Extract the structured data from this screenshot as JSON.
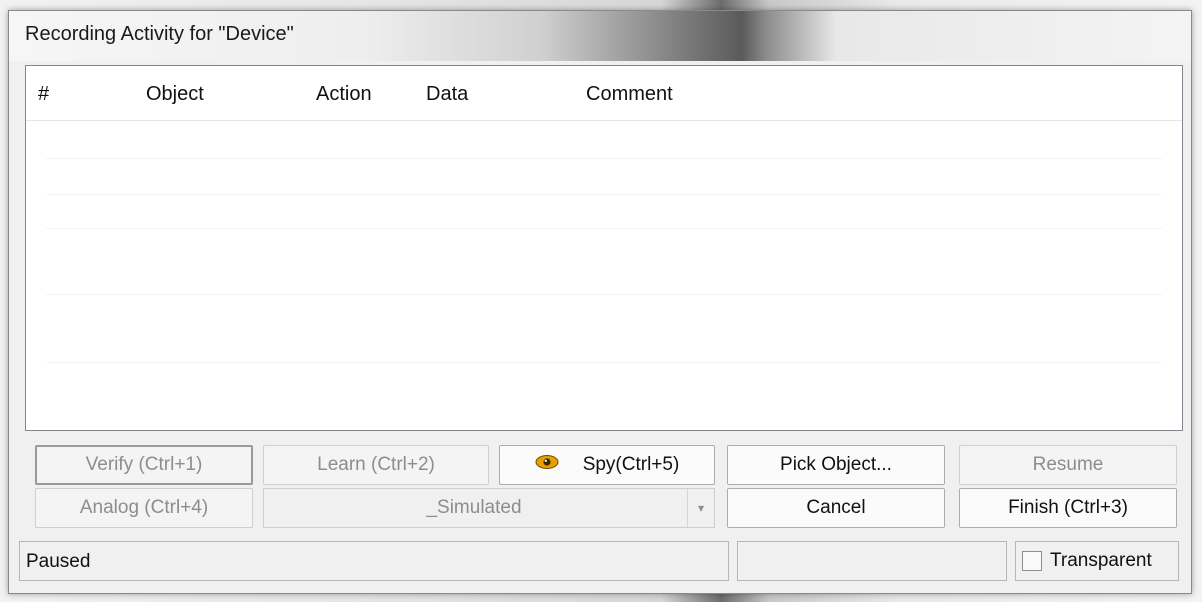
{
  "window": {
    "title": "Recording Activity for \"Device\""
  },
  "list": {
    "columns": [
      "#",
      "Object",
      "Action",
      "Data",
      "Comment"
    ]
  },
  "buttons": {
    "verify": "Verify (Ctrl+1)",
    "learn": "Learn (Ctrl+2)",
    "spy": "Spy(Ctrl+5)",
    "pick_object": "Pick Object...",
    "resume": "Resume",
    "analog": "Analog (Ctrl+4)",
    "cancel": "Cancel",
    "finish": "Finish (Ctrl+3)"
  },
  "mode_select": {
    "selected": "_Simulated"
  },
  "status": {
    "text": "Paused",
    "transparent_label": "Transparent",
    "transparent_checked": false
  },
  "icons": {
    "spy": "eye-icon",
    "dropdown": "chevron-down-icon"
  },
  "colors": {
    "spy_icon": "#e6a100",
    "disabled_text": "#8d8d8d"
  }
}
